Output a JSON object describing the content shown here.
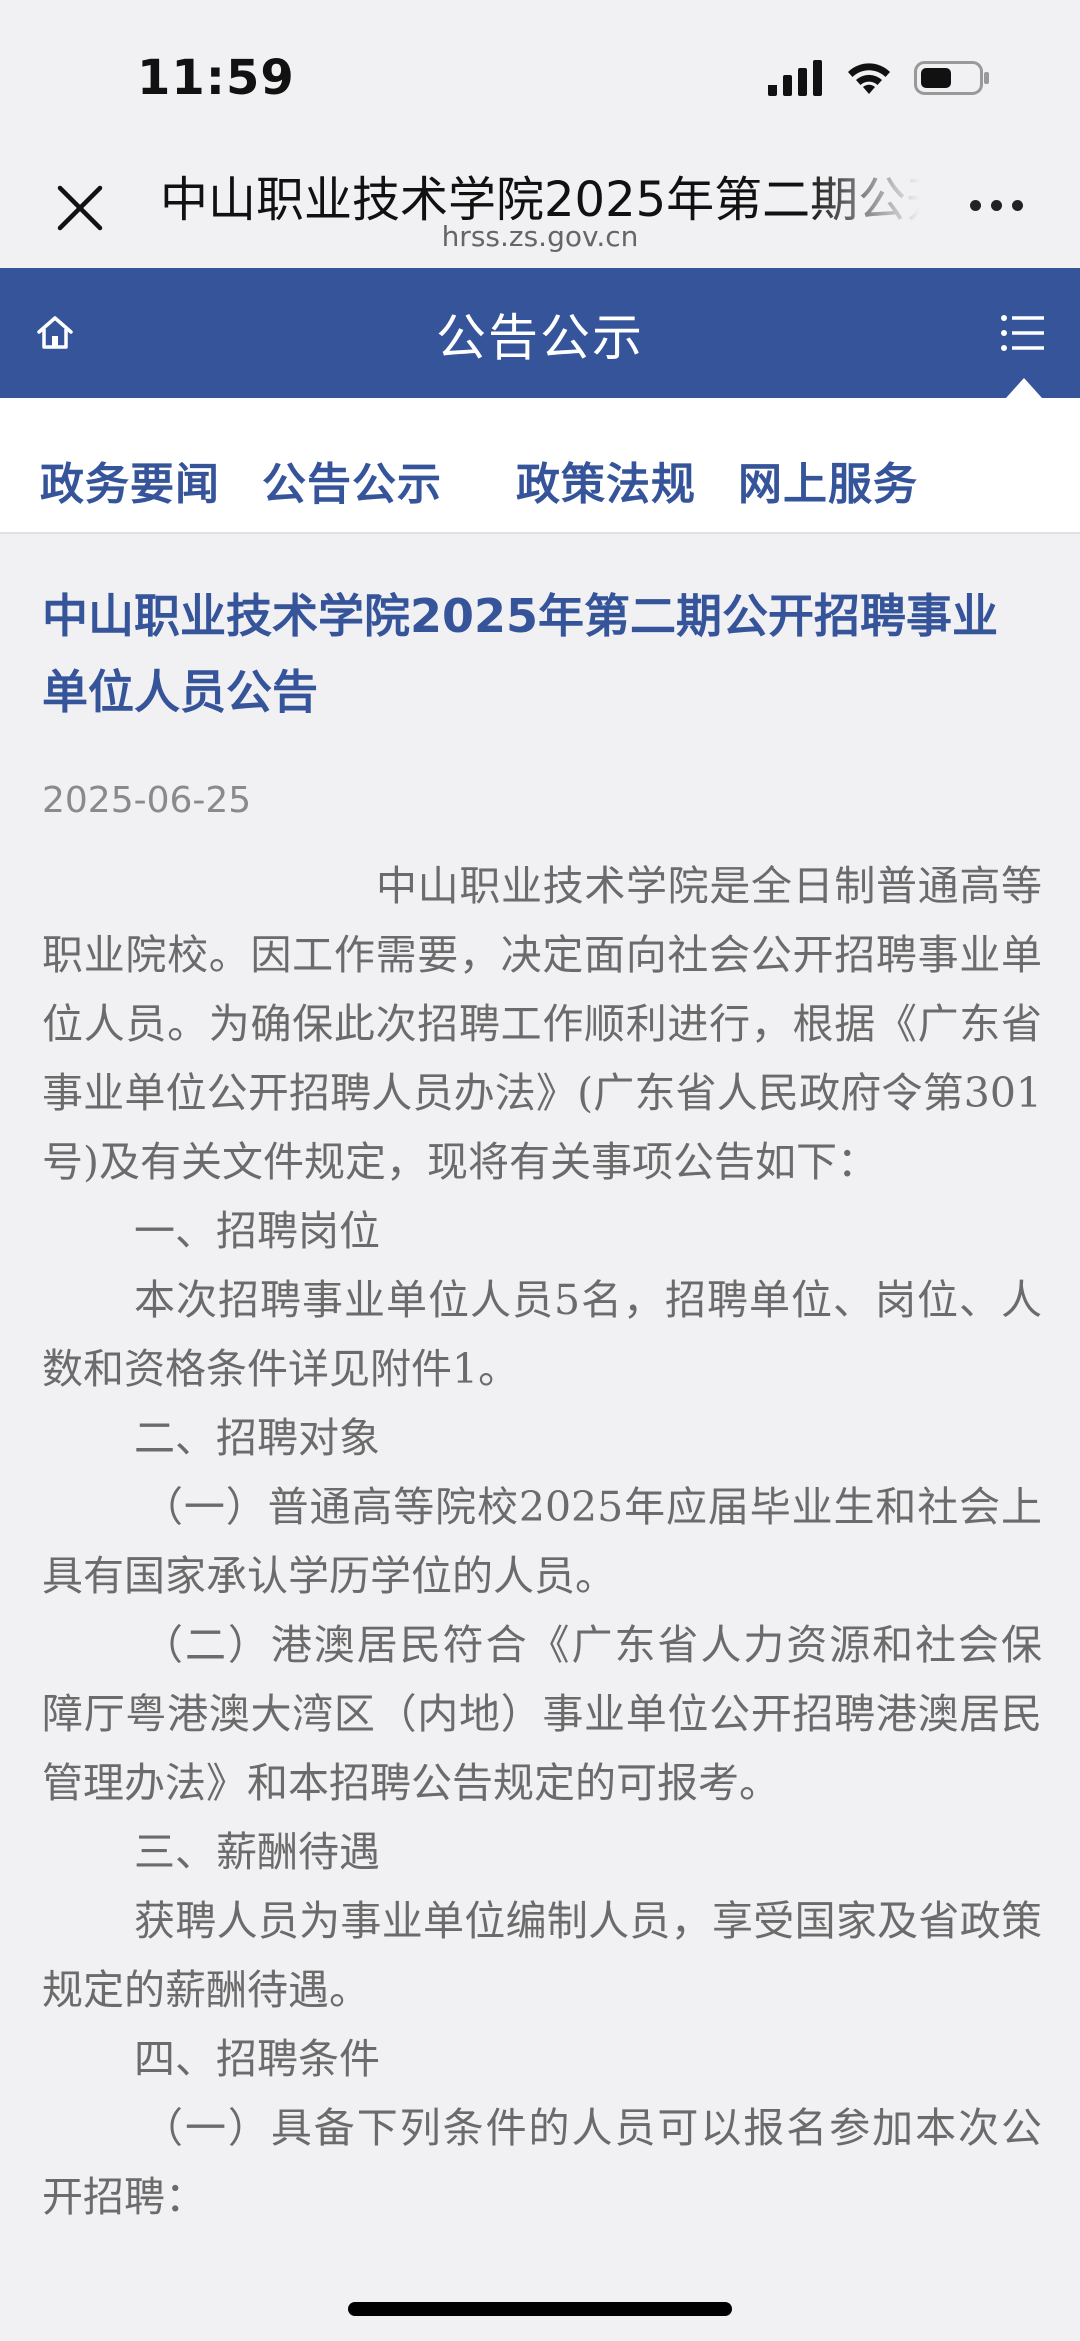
{
  "status_bar": {
    "time": "11:59"
  },
  "browser": {
    "title": "中山职业技术学院2025年第二期公开招聘事业单位人员公告",
    "url": "hrss.zs.gov.cn"
  },
  "header": {
    "title": "公告公示"
  },
  "sub_nav": {
    "items": [
      {
        "label": "政务要闻"
      },
      {
        "label": "公告公示"
      },
      {
        "label": "政策法规"
      },
      {
        "label": "网上服务"
      }
    ]
  },
  "article": {
    "title": "中山职业技术学院2025年第二期公开招聘事业单位人员公告",
    "date": "2025-06-25",
    "paragraphs": [
      "中山职业技术学院是全日制普通高等职业院校。因工作需要，决定面向社会公开招聘事业单位人员。为确保此次招聘工作顺利进行，根据《广东省事业单位公开招聘人员办法》(广东省人民政府令第301号)及有关文件规定，现将有关事项公告如下：",
      "一、招聘岗位",
      "本次招聘事业单位人员5名，招聘单位、岗位、人数和资格条件详见附件1。",
      "二、招聘对象",
      "（一）普通高等院校2025年应届毕业生和社会上具有国家承认学历学位的人员。",
      "（二）港澳居民符合《广东省人力资源和社会保障厅粤港澳大湾区（内地）事业单位公开招聘港澳居民管理办法》和本招聘公告规定的可报考。",
      "三、薪酬待遇",
      "获聘人员为事业单位编制人员，享受国家及省政策规定的薪酬待遇。",
      "四、招聘条件",
      "（一）具备下列条件的人员可以报名参加本次公开招聘："
    ]
  },
  "colors": {
    "accent": "#36549a",
    "body_text": "#6b6b6b",
    "background": "#f1f1f3"
  }
}
